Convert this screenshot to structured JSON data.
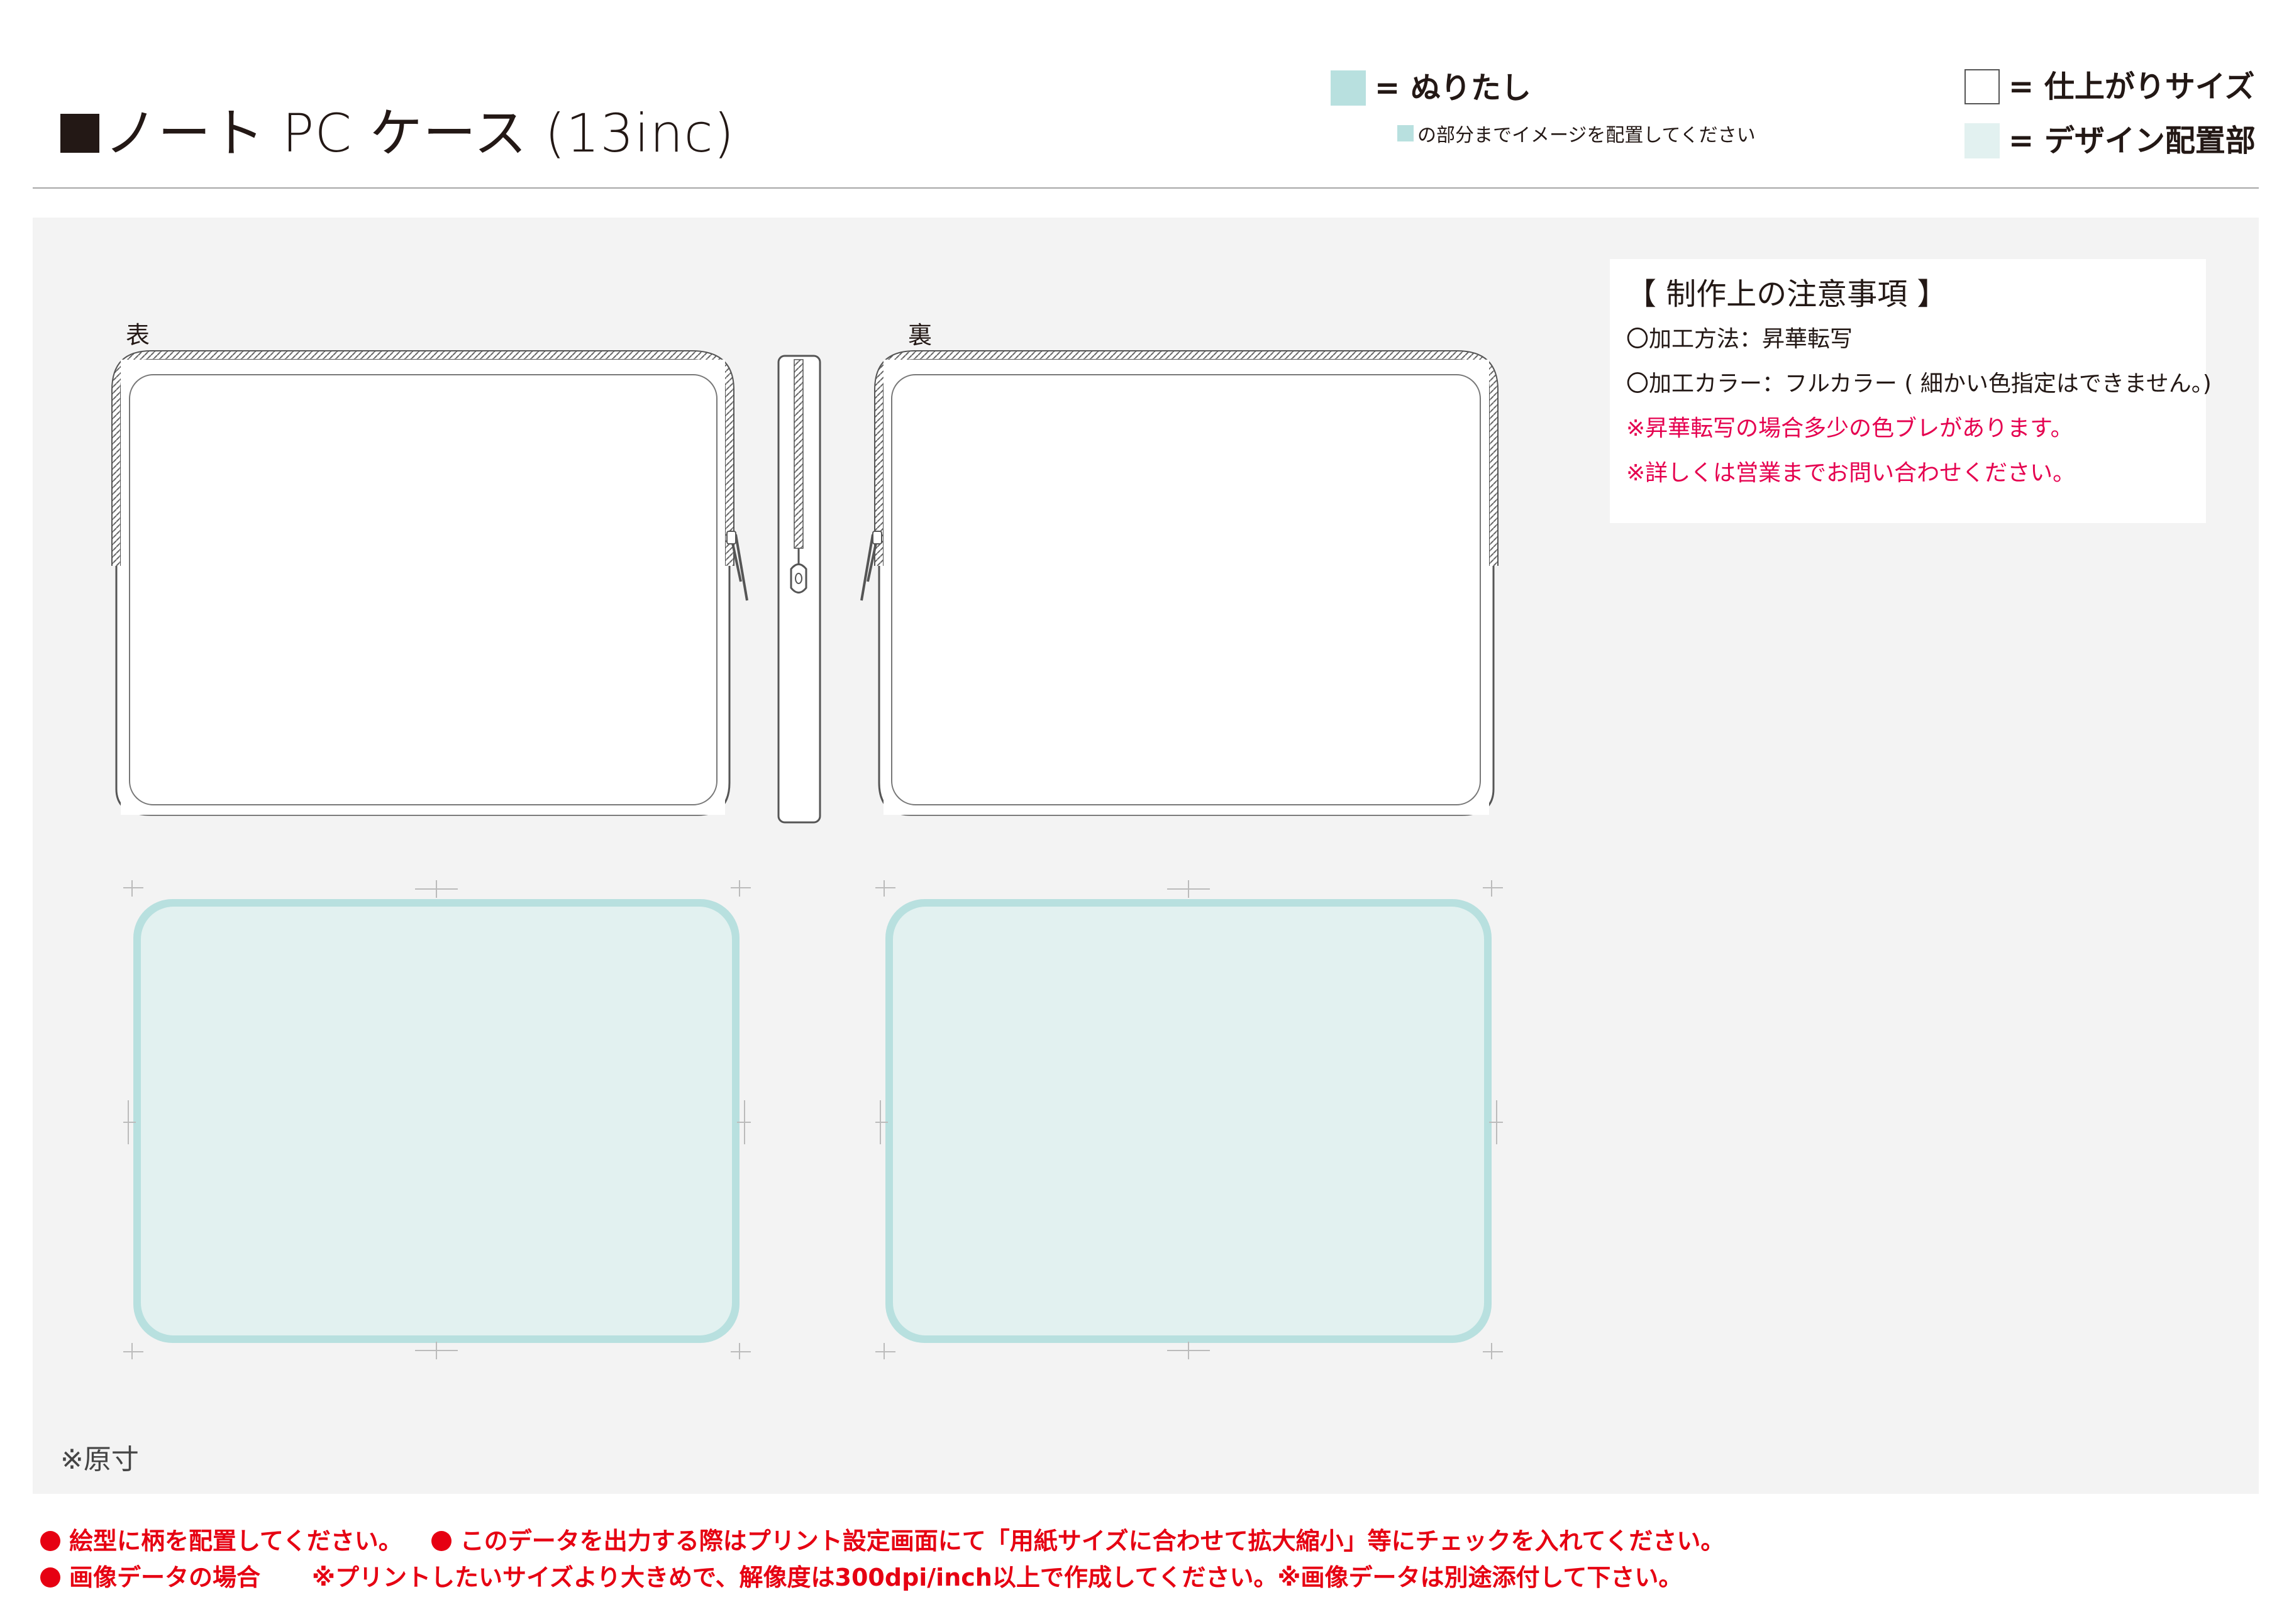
{
  "header": {
    "title": "ノート PC ケース (13inc)"
  },
  "legend": {
    "bleed_label": "= ぬりたし",
    "bleed_note": "の部分までイメージを配置してください",
    "finish_label": "= 仕上がりサイズ",
    "design_label": "= デザイン配置部",
    "colors": {
      "bleed": "#b8e0df",
      "finish": "#ffffff",
      "design": "#e2f1f0"
    }
  },
  "views": {
    "front_label": "表",
    "back_label": "裏"
  },
  "notice": {
    "title": "【 制作上の注意事項 】",
    "lines": [
      "〇加工方法：昇華転写",
      "〇加工カラー：フルカラー ( 細かい色指定はできません。)",
      "※昇華転写の場合多少の色ブレがあります。",
      "※詳しくは営業までお問い合わせください。"
    ]
  },
  "scale_note": "※原寸",
  "footer": {
    "item1": "絵型に柄を配置してください。",
    "item2": "このデータを出力する際はプリント設定画面にて「用紙サイズに合わせて拡大縮小」等にチェックを入れてください。",
    "item3_label": "画像データの場合",
    "item3_text": "※プリントしたいサイズより大きめで、解像度は300dpi/inch以上で作成してください。※画像データは別途添付して下さい。",
    "accent_color": "#e60012"
  }
}
